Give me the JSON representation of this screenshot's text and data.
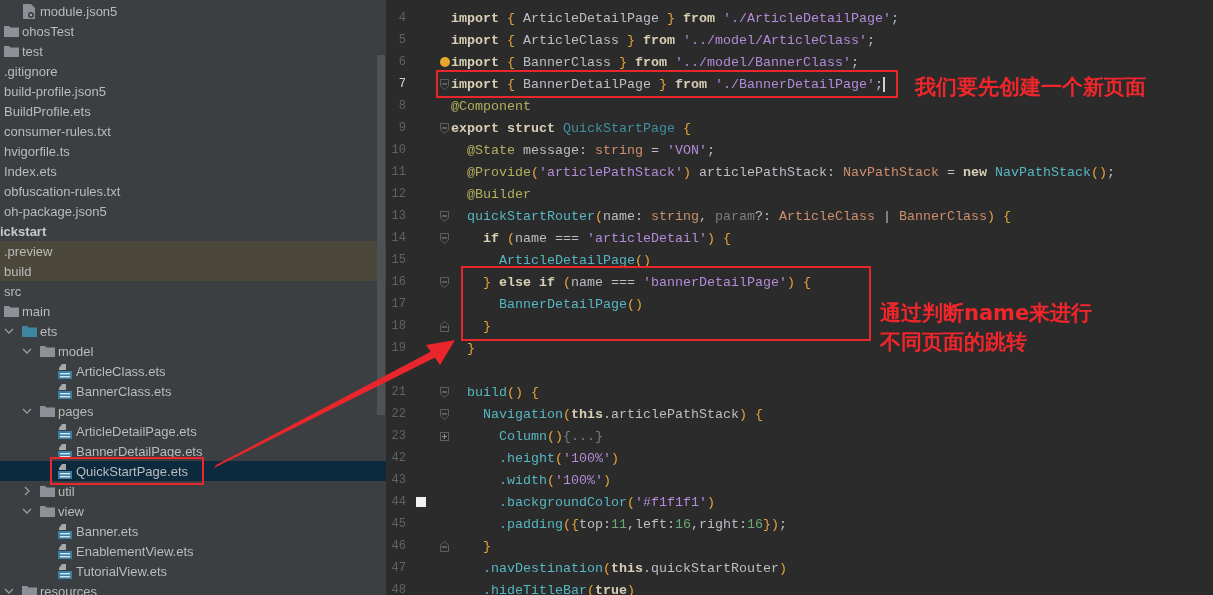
{
  "project_tree": {
    "above": [
      {
        "label": "module.json5",
        "kind": "json-file",
        "selected": false
      },
      {
        "label": "ohosTest",
        "kind": "folder",
        "selected": false
      },
      {
        "label": "test",
        "kind": "folder",
        "selected": false
      },
      {
        "label": ".gitignore",
        "kind": "file",
        "selected": false
      },
      {
        "label": "build-profile.json5",
        "kind": "file",
        "selected": false
      },
      {
        "label": "BuildProfile.ets",
        "kind": "file",
        "selected": false
      },
      {
        "label": "consumer-rules.txt",
        "kind": "file",
        "selected": false
      },
      {
        "label": "hvigorfile.ts",
        "kind": "file",
        "selected": false
      },
      {
        "label": "Index.ets",
        "kind": "file",
        "selected": false
      },
      {
        "label": "obfuscation-rules.txt",
        "kind": "file",
        "selected": false
      },
      {
        "label": "oh-package.json5",
        "kind": "file",
        "selected": false
      }
    ],
    "tree": [
      {
        "label": "ickstart",
        "kind": "module",
        "selected": false,
        "children": [
          {
            "label": ".preview",
            "selected": false,
            "excluded": true
          },
          {
            "label": "build",
            "selected": false,
            "excluded": true
          },
          {
            "label": "src",
            "selected": false,
            "children": [
              {
                "label": "main",
                "kind": "folder",
                "selected": false,
                "children": [
                  {
                    "label": "ets",
                    "kind": "source-folder",
                    "selected": false,
                    "expanded": true,
                    "children": [
                      {
                        "label": "model",
                        "kind": "folder",
                        "selected": false,
                        "expanded": true,
                        "children": [
                          {
                            "label": "ArticleClass.ets",
                            "kind": "ets-file",
                            "selected": false
                          },
                          {
                            "label": "BannerClass.ets",
                            "kind": "ets-file",
                            "selected": false
                          }
                        ]
                      },
                      {
                        "label": "pages",
                        "kind": "folder",
                        "selected": false,
                        "expanded": true,
                        "children": [
                          {
                            "label": "ArticleDetailPage.ets",
                            "kind": "ets-file",
                            "selected": false
                          },
                          {
                            "label": "BannerDetailPage.ets",
                            "kind": "ets-file",
                            "selected": false
                          },
                          {
                            "label": "QuickStartPage.ets",
                            "kind": "ets-file",
                            "selected": true
                          }
                        ]
                      },
                      {
                        "label": "util",
                        "kind": "folder",
                        "selected": false,
                        "expanded": false
                      },
                      {
                        "label": "view",
                        "kind": "folder",
                        "selected": false,
                        "expanded": true,
                        "children": [
                          {
                            "label": "Banner.ets",
                            "kind": "ets-file",
                            "selected": false
                          },
                          {
                            "label": "EnablementView.ets",
                            "kind": "ets-file",
                            "selected": false
                          },
                          {
                            "label": "TutorialView.ets",
                            "kind": "ets-file",
                            "selected": false
                          }
                        ]
                      }
                    ]
                  },
                  {
                    "label": "resources",
                    "kind": "folder",
                    "selected": false,
                    "expanded": true
                  }
                ]
              }
            ]
          }
        ]
      }
    ]
  },
  "editor": {
    "lines": [
      {
        "number": "4",
        "tokens": [
          {
            "text": "import ",
            "kind": "k"
          },
          {
            "text": "{",
            "kind": "b"
          },
          {
            "text": " ArticleDetailPage ",
            "kind": "p"
          },
          {
            "text": "}",
            "kind": "b"
          },
          {
            "text": " from ",
            "kind": "k"
          },
          {
            "text": "'./ArticleDetailPage'",
            "kind": "s"
          },
          {
            "text": ";",
            "kind": "p"
          }
        ]
      },
      {
        "number": "5",
        "tokens": [
          {
            "text": "import ",
            "kind": "k"
          },
          {
            "text": "{",
            "kind": "b"
          },
          {
            "text": " ArticleClass ",
            "kind": "p"
          },
          {
            "text": "}",
            "kind": "b"
          },
          {
            "text": " from ",
            "kind": "k"
          },
          {
            "text": "'../model/ArticleClass'",
            "kind": "s"
          },
          {
            "text": ";",
            "kind": "p"
          }
        ]
      },
      {
        "number": "6",
        "bulb": true,
        "tokens": [
          {
            "text": "import ",
            "kind": "k"
          },
          {
            "text": "{",
            "kind": "b"
          },
          {
            "text": " BannerClass ",
            "kind": "p"
          },
          {
            "text": "}",
            "kind": "b"
          },
          {
            "text": " from ",
            "kind": "k"
          },
          {
            "text": "'../model/BannerClass'",
            "kind": "s"
          },
          {
            "text": ";",
            "kind": "p"
          }
        ]
      },
      {
        "number": "7",
        "current": true,
        "caret": true,
        "fold_open": true,
        "tokens": [
          {
            "text": "import ",
            "kind": "k"
          },
          {
            "text": "{",
            "kind": "b"
          },
          {
            "text": " BannerDetailPage ",
            "kind": "p"
          },
          {
            "text": "}",
            "kind": "b"
          },
          {
            "text": " from ",
            "kind": "k"
          },
          {
            "text": "'./BannerDetailPage'",
            "kind": "s"
          },
          {
            "text": ";",
            "kind": "p"
          }
        ]
      },
      {
        "number": "8",
        "tokens": [
          {
            "text": "@Component",
            "kind": "d"
          }
        ]
      },
      {
        "number": "9",
        "fold_open": true,
        "tokens": [
          {
            "text": "export struct ",
            "kind": "k"
          },
          {
            "text": "QuickStartPage ",
            "kind": "c"
          },
          {
            "text": "{",
            "kind": "b"
          }
        ]
      },
      {
        "number": "10",
        "tokens": [
          {
            "text": "  @State",
            "kind": "d"
          },
          {
            "text": " message: ",
            "kind": "p"
          },
          {
            "text": "string",
            "kind": "t"
          },
          {
            "text": " = ",
            "kind": "p"
          },
          {
            "text": "'VON'",
            "kind": "s"
          },
          {
            "text": ";",
            "kind": "p"
          }
        ]
      },
      {
        "number": "11",
        "tokens": [
          {
            "text": "  @Provide",
            "kind": "d"
          },
          {
            "text": "(",
            "kind": "b"
          },
          {
            "text": "'articlePathStack'",
            "kind": "s"
          },
          {
            "text": ")",
            "kind": "b"
          },
          {
            "text": " articlePathStack: ",
            "kind": "p"
          },
          {
            "text": "NavPathStack",
            "kind": "t"
          },
          {
            "text": " = ",
            "kind": "p"
          },
          {
            "text": "new ",
            "kind": "k"
          },
          {
            "text": "NavPathStack",
            "kind": "f"
          },
          {
            "text": "()",
            "kind": "b"
          },
          {
            "text": ";",
            "kind": "p"
          }
        ]
      },
      {
        "number": "12",
        "tokens": [
          {
            "text": "  @Builder",
            "kind": "d"
          }
        ]
      },
      {
        "number": "13",
        "fold_open": true,
        "tokens": [
          {
            "text": "  quickStartRouter",
            "kind": "f"
          },
          {
            "text": "(",
            "kind": "b"
          },
          {
            "text": "name: ",
            "kind": "p"
          },
          {
            "text": "string",
            "kind": "t"
          },
          {
            "text": ", ",
            "kind": "p"
          },
          {
            "text": "param",
            "kind": "m"
          },
          {
            "text": "?: ",
            "kind": "p"
          },
          {
            "text": "ArticleClass",
            "kind": "t"
          },
          {
            "text": " | ",
            "kind": "p"
          },
          {
            "text": "BannerClass",
            "kind": "t"
          },
          {
            "text": ")",
            "kind": "b"
          },
          {
            "text": " {",
            "kind": "b"
          }
        ]
      },
      {
        "number": "14",
        "fold_open": true,
        "tokens": [
          {
            "text": "    if ",
            "kind": "k"
          },
          {
            "text": "(",
            "kind": "b"
          },
          {
            "text": "name === ",
            "kind": "p"
          },
          {
            "text": "'articleDetail'",
            "kind": "s"
          },
          {
            "text": ")",
            "kind": "b"
          },
          {
            "text": " {",
            "kind": "b"
          }
        ]
      },
      {
        "number": "15",
        "tokens": [
          {
            "text": "      ArticleDetailPage",
            "kind": "f"
          },
          {
            "text": "()",
            "kind": "b"
          }
        ]
      },
      {
        "number": "16",
        "fold_open": true,
        "tokens": [
          {
            "text": "    }",
            "kind": "b"
          },
          {
            "text": " else if ",
            "kind": "k"
          },
          {
            "text": "(",
            "kind": "b"
          },
          {
            "text": "name === ",
            "kind": "p"
          },
          {
            "text": "'bannerDetailPage'",
            "kind": "s"
          },
          {
            "text": ")",
            "kind": "b"
          },
          {
            "text": " {",
            "kind": "b"
          }
        ]
      },
      {
        "number": "17",
        "tokens": [
          {
            "text": "      BannerDetailPage",
            "kind": "f"
          },
          {
            "text": "()",
            "kind": "b"
          }
        ]
      },
      {
        "number": "18",
        "fold_close": true,
        "tokens": [
          {
            "text": "    }",
            "kind": "b"
          }
        ]
      },
      {
        "number": "19",
        "tokens": [
          {
            "text": "  }",
            "kind": "b"
          }
        ]
      },
      {
        "number": "21",
        "fold_open": true,
        "tokens": [
          {
            "text": "  build",
            "kind": "f"
          },
          {
            "text": "()",
            "kind": "b"
          },
          {
            "text": " {",
            "kind": "b"
          }
        ]
      },
      {
        "number": "22",
        "fold_open": true,
        "tokens": [
          {
            "text": "    Navigation",
            "kind": "f"
          },
          {
            "text": "(",
            "kind": "b"
          },
          {
            "text": "this",
            "kind": "k"
          },
          {
            "text": ".articlePathStack",
            "kind": "p"
          },
          {
            "text": ")",
            "kind": "b"
          },
          {
            "text": " {",
            "kind": "b"
          }
        ]
      },
      {
        "number": "23",
        "folded": true,
        "tokens": [
          {
            "text": "      Column",
            "kind": "f"
          },
          {
            "text": "()",
            "kind": "b"
          },
          {
            "text": "{...}",
            "kind": "m"
          }
        ]
      },
      {
        "number": "42",
        "tokens": [
          {
            "text": "      .height",
            "kind": "f"
          },
          {
            "text": "(",
            "kind": "b"
          },
          {
            "text": "'100%'",
            "kind": "s"
          },
          {
            "text": ")",
            "kind": "b"
          }
        ]
      },
      {
        "number": "43",
        "tokens": [
          {
            "text": "      .width",
            "kind": "f"
          },
          {
            "text": "(",
            "kind": "b"
          },
          {
            "text": "'100%'",
            "kind": "s"
          },
          {
            "text": ")",
            "kind": "b"
          }
        ]
      },
      {
        "number": "44",
        "color": "#f1f1f1",
        "tokens": [
          {
            "text": "      .backgroundColor",
            "kind": "f"
          },
          {
            "text": "(",
            "kind": "b"
          },
          {
            "text": "'#f1f1f1'",
            "kind": "s"
          },
          {
            "text": ")",
            "kind": "b"
          }
        ]
      },
      {
        "number": "45",
        "tokens": [
          {
            "text": "      .padding",
            "kind": "f"
          },
          {
            "text": "(",
            "kind": "b"
          },
          {
            "text": "{",
            "kind": "b"
          },
          {
            "text": "top:",
            "kind": "p"
          },
          {
            "text": "11",
            "kind": "n"
          },
          {
            "text": ",left:",
            "kind": "p"
          },
          {
            "text": "16",
            "kind": "n"
          },
          {
            "text": ",right:",
            "kind": "p"
          },
          {
            "text": "16",
            "kind": "n"
          },
          {
            "text": "}",
            "kind": "b"
          },
          {
            "text": ")",
            "kind": "b"
          },
          {
            "text": ";",
            "kind": "p"
          }
        ]
      },
      {
        "number": "46",
        "fold_close": true,
        "tokens": [
          {
            "text": "    }",
            "kind": "b"
          }
        ]
      },
      {
        "number": "47",
        "tokens": [
          {
            "text": "    .navDestination",
            "kind": "f"
          },
          {
            "text": "(",
            "kind": "b"
          },
          {
            "text": "this",
            "kind": "k"
          },
          {
            "text": ".quickStartRouter",
            "kind": "p"
          },
          {
            "text": ")",
            "kind": "b"
          }
        ]
      },
      {
        "number": "48",
        "tokens": [
          {
            "text": "    .hideTitleBar",
            "kind": "f"
          },
          {
            "text": "(",
            "kind": "b"
          },
          {
            "text": "true",
            "kind": "k"
          },
          {
            "text": ")",
            "kind": "b"
          }
        ]
      }
    ]
  },
  "annotations": [
    {
      "lines": [
        "我们要先创建一个新页面"
      ]
    },
    {
      "lines": [
        "通过判断name来进行",
        "不同页面的跳转"
      ]
    }
  ]
}
